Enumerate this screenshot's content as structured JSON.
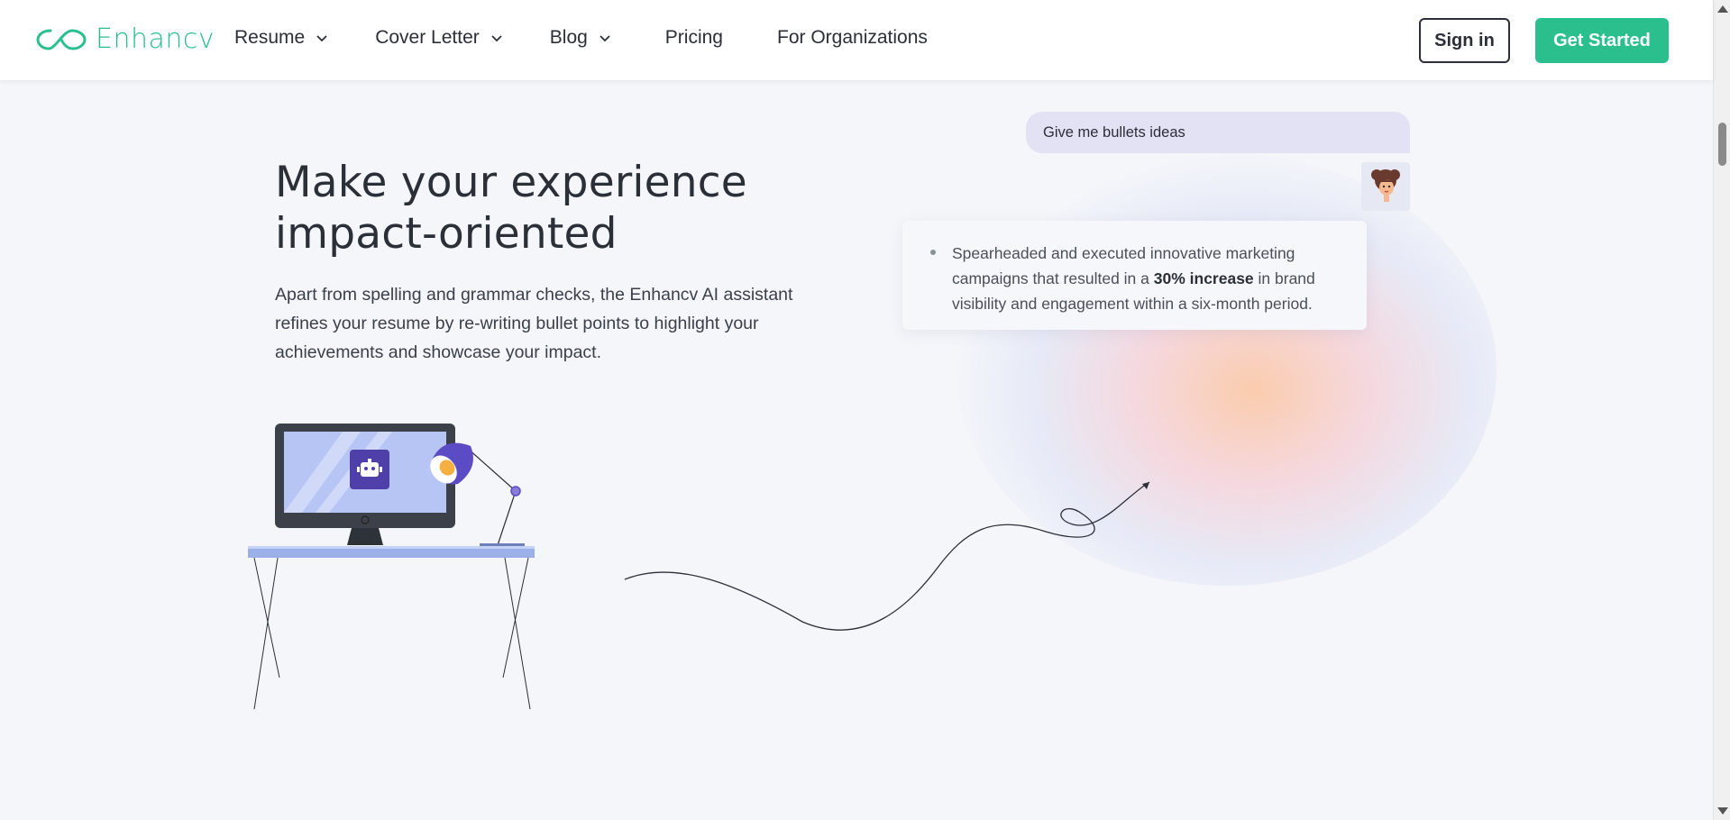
{
  "header": {
    "logo_text": "Enhancv",
    "nav": [
      {
        "label": "Resume",
        "has_dropdown": true
      },
      {
        "label": "Cover Letter",
        "has_dropdown": true
      },
      {
        "label": "Blog",
        "has_dropdown": true
      },
      {
        "label": "Pricing",
        "has_dropdown": false
      },
      {
        "label": "For Organizations",
        "has_dropdown": false
      }
    ],
    "signin_label": "Sign in",
    "get_started_label": "Get Started"
  },
  "hero": {
    "headline": "Make your experience impact-oriented",
    "description": "Apart from spelling and grammar checks, the Enhancv AI assistant refines your resume by re-writing bullet points to highlight your achievements and showcase your impact."
  },
  "chat": {
    "prompt": "Give me bullets ideas",
    "response_before": "Spearheaded and executed innovative marketing campaigns that resulted in a ",
    "response_bold": "30% increase",
    "response_after": " in brand visibility and engagement within a six-month period."
  },
  "icons": [
    "infinity-logo-icon",
    "chevron-down-icon",
    "robot-icon",
    "avatar-illustration",
    "desk-illustration",
    "arrow-curve-icon"
  ],
  "colors": {
    "brand": "#2bbf8e",
    "text": "#2b2f38",
    "background": "#f4f6fa",
    "prompt_bubble": "#e3e1f4",
    "illustration_accent": "#5b4bc4"
  }
}
